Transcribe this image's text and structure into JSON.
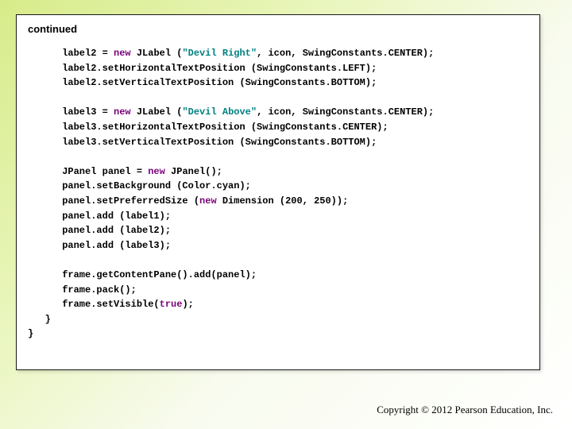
{
  "header": {
    "continued": "continued"
  },
  "code": {
    "l1a": "      label2 = ",
    "l1_kw": "new",
    "l1b": " JLabel (",
    "l1_str": "\"Devil Right\"",
    "l1c": ", icon, SwingConstants.CENTER);",
    "l2": "      label2.setHorizontalTextPosition (SwingConstants.LEFT);",
    "l3": "      label2.setVerticalTextPosition (SwingConstants.BOTTOM);",
    "l5a": "      label3 = ",
    "l5_kw": "new",
    "l5b": " JLabel (",
    "l5_str": "\"Devil Above\"",
    "l5c": ", icon, SwingConstants.CENTER);",
    "l6": "      label3.setHorizontalTextPosition (SwingConstants.CENTER);",
    "l7": "      label3.setVerticalTextPosition (SwingConstants.BOTTOM);",
    "l9a": "      JPanel panel = ",
    "l9_kw": "new",
    "l9b": " JPanel();",
    "l10": "      panel.setBackground (Color.cyan);",
    "l11a": "      panel.setPreferredSize (",
    "l11_kw": "new",
    "l11b": " Dimension (200, 250));",
    "l12": "      panel.add (label1);",
    "l13": "      panel.add (label2);",
    "l14": "      panel.add (label3);",
    "l16": "      frame.getContentPane().add(panel);",
    "l17": "      frame.pack();",
    "l18a": "      frame.setVisible(",
    "l18_kw": "true",
    "l18b": ");",
    "l19": "   }",
    "l20": "}"
  },
  "footer": {
    "copyright": "Copyright © 2012 Pearson Education, Inc."
  }
}
